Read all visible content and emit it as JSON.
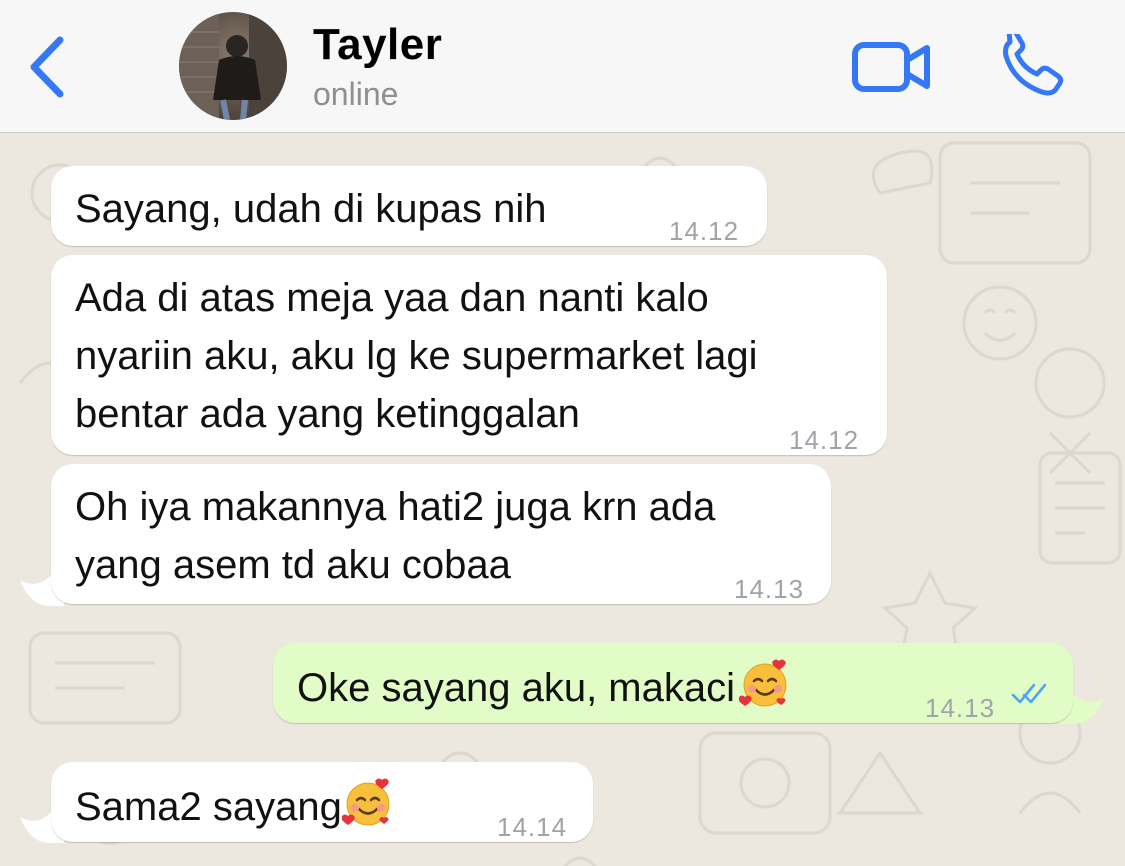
{
  "header": {
    "back_icon": "chevron-left-icon",
    "contact_name": "Tayler",
    "contact_status": "online",
    "video_icon": "video-camera-icon",
    "call_icon": "phone-icon",
    "accent_color": "#3478f6"
  },
  "messages": [
    {
      "direction": "incoming",
      "text": "Sayang, udah di kupas nih",
      "time": "14.12"
    },
    {
      "direction": "incoming",
      "text": "Ada di atas meja yaa dan nanti kalo\nnyariin aku, aku lg ke supermarket lagi\nbentar ada yang ketinggalan",
      "time": "14.12"
    },
    {
      "direction": "incoming",
      "text": "Oh iya makannya hati2 juga krn ada\nyang asem td aku cobaa",
      "time": "14.13"
    },
    {
      "direction": "outgoing",
      "text": "Oke sayang aku, makaci",
      "emoji": "smiling-face-with-hearts",
      "time": "14.13",
      "read_status": "read-double-check"
    },
    {
      "direction": "incoming",
      "text": "Sama2 sayang",
      "emoji": "smiling-face-with-hearts",
      "time": "14.14"
    }
  ],
  "colors": {
    "incoming_bubble": "#ffffff",
    "outgoing_bubble": "#e2fcc7",
    "wallpaper": "#ece7df",
    "read_check": "#4fa7ef"
  }
}
